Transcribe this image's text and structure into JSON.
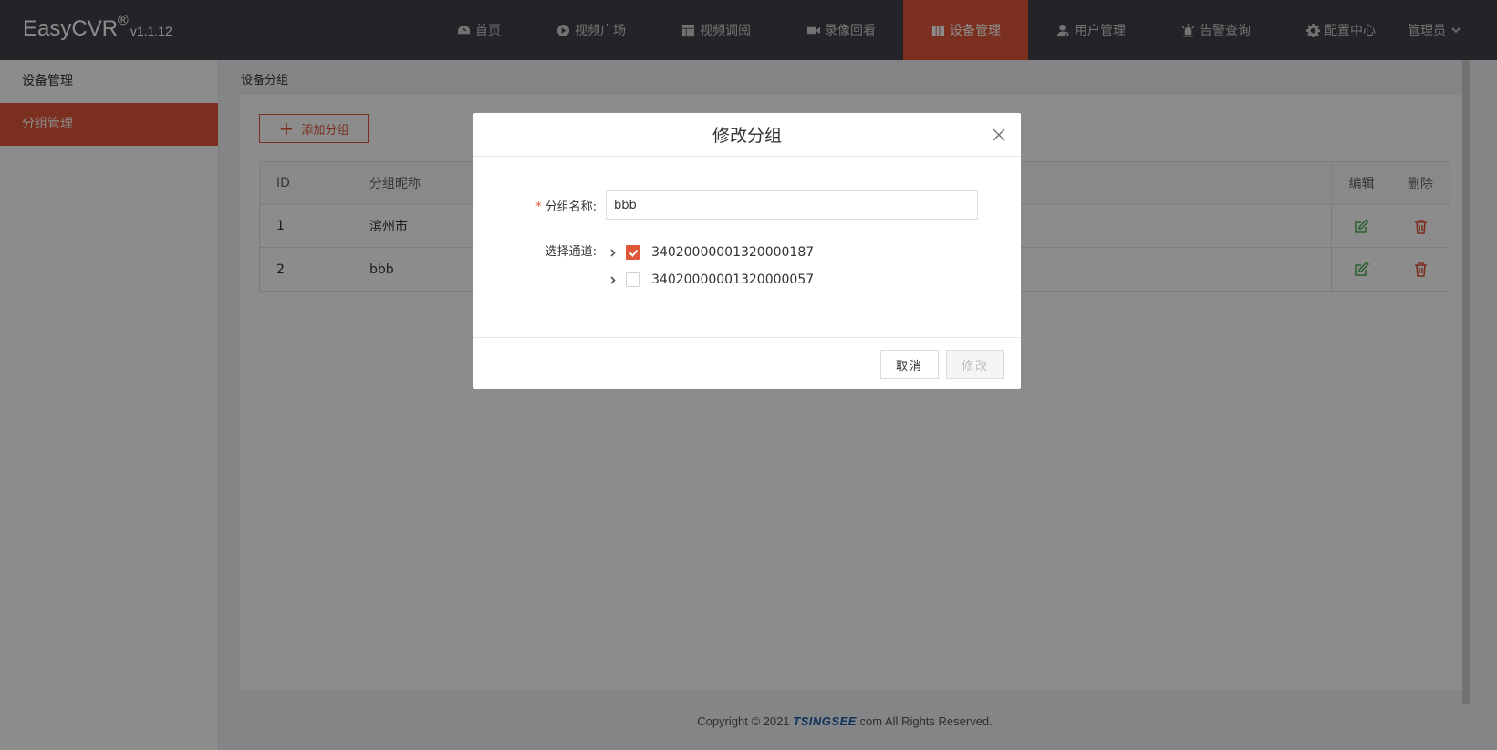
{
  "app": {
    "name": "EasyCVR",
    "registered": "®",
    "version": "v1.1.12"
  },
  "nav": [
    {
      "label": "首页",
      "icon": "dashboard-icon"
    },
    {
      "label": "视频广场",
      "icon": "play-icon"
    },
    {
      "label": "视频调阅",
      "icon": "layout-icon"
    },
    {
      "label": "录像回看",
      "icon": "video-camera-icon"
    },
    {
      "label": "设备管理",
      "icon": "device-icon",
      "active": true
    },
    {
      "label": "用户管理",
      "icon": "user-icon"
    },
    {
      "label": "告警查询",
      "icon": "alarm-icon"
    },
    {
      "label": "配置中心",
      "icon": "gear-icon"
    }
  ],
  "user": {
    "label": "管理员"
  },
  "sidebar": {
    "items": [
      {
        "label": "设备管理"
      },
      {
        "label": "分组管理",
        "active": true
      }
    ]
  },
  "breadcrumb": "设备分组",
  "toolbar": {
    "add_label": "添加分组"
  },
  "table": {
    "headers": {
      "id": "ID",
      "name": "分组昵称",
      "edit": "编辑",
      "delete": "删除"
    },
    "rows": [
      {
        "id": "1",
        "name": "滨州市"
      },
      {
        "id": "2",
        "name": "bbb"
      }
    ]
  },
  "footer": {
    "prefix": "Copyright © 2021 ",
    "brand": "TSINGSEE",
    "suffix": ".com All Rights Reserved."
  },
  "modal": {
    "title": "修改分组",
    "name_label": "分组名称:",
    "name_value": "bbb",
    "channel_label": "选择通道:",
    "channels": [
      {
        "label": "34020000001320000187",
        "checked": true
      },
      {
        "label": "34020000001320000057",
        "checked": false
      }
    ],
    "cancel_label": "取消",
    "submit_label": "修改"
  },
  "colors": {
    "accent": "#e0573a",
    "header_bg": "#3f4347",
    "edit_green": "#4caf50",
    "delete_red": "#e0573a"
  }
}
